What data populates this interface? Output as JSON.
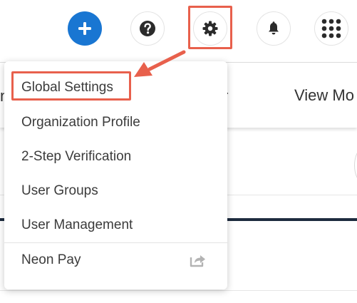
{
  "toolbar": {
    "buttons": [
      {
        "icon": "plus-icon",
        "color": "#1976d2"
      },
      {
        "icon": "help-icon"
      },
      {
        "icon": "gear-icon"
      },
      {
        "icon": "bell-icon"
      },
      {
        "icon": "apps-grid-icon"
      }
    ]
  },
  "page": {
    "nav_left_fragment": "n",
    "nav_mid_fragment": "r",
    "nav_view_more": "View Mo"
  },
  "menu": {
    "items": [
      {
        "label": "Global Settings",
        "highlighted": true
      },
      {
        "label": "Organization Profile"
      },
      {
        "label": "2-Step Verification"
      },
      {
        "label": "User Groups"
      },
      {
        "label": "User Management"
      },
      {
        "label": "Neon Pay",
        "icon": "external-link-icon"
      }
    ]
  },
  "colors": {
    "accent": "#1976d2",
    "annotation": "#e8604c",
    "navy": "#1d2b3e"
  }
}
